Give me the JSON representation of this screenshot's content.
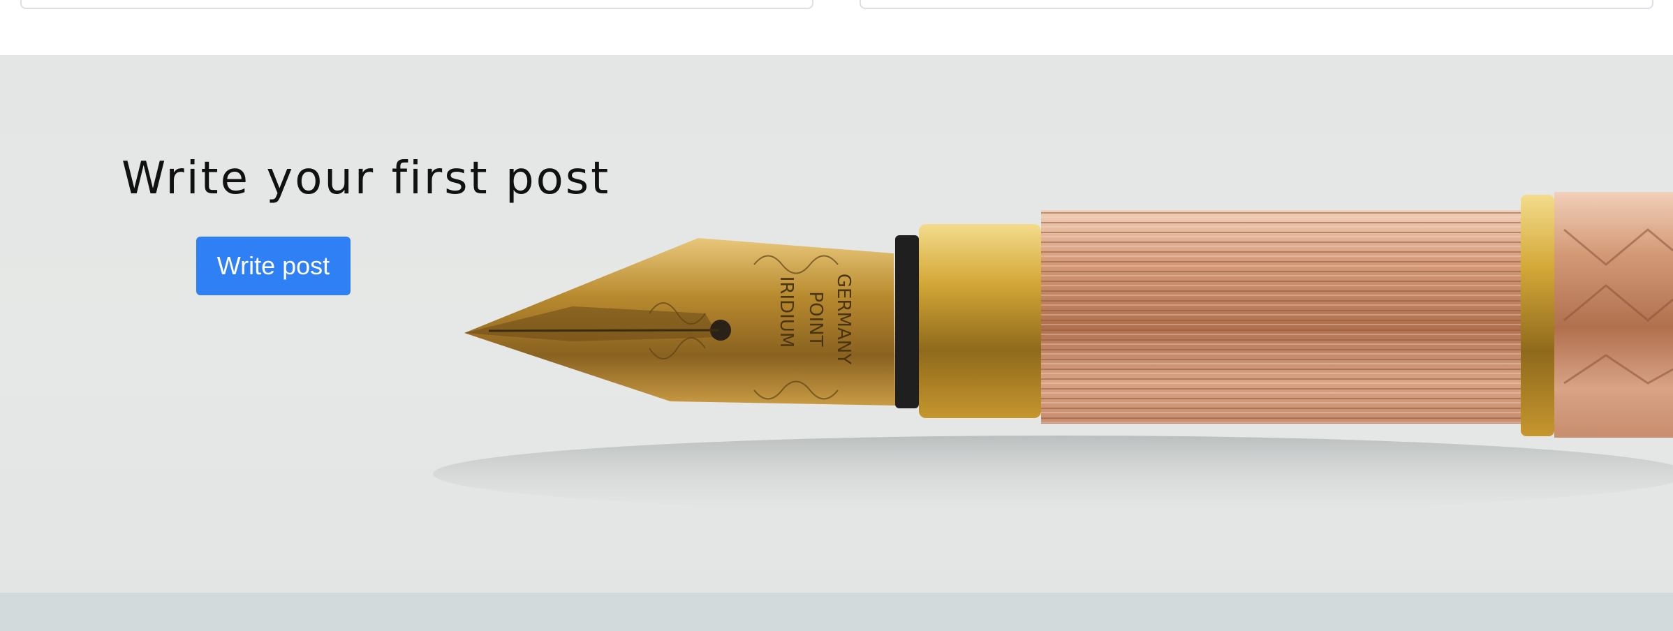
{
  "hero": {
    "title": "Write your first post",
    "button_label": "Write post"
  },
  "pen_engraving": [
    "IRIDIUM",
    "POINT",
    "GERMANY"
  ],
  "colors": {
    "button": "#2f80f5",
    "hero_background": "#e4e6e5",
    "bottom_band": "#d3dadc",
    "pen_gold": "#c9a24a",
    "pen_rose": "#d9a487"
  },
  "icons": {
    "hero_image": "fountain-pen-image"
  }
}
